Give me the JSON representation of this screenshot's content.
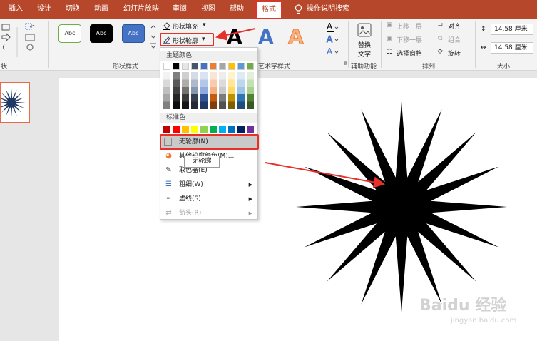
{
  "tabs": [
    {
      "label": "插入"
    },
    {
      "label": "设计"
    },
    {
      "label": "切换"
    },
    {
      "label": "动画"
    },
    {
      "label": "幻灯片放映"
    },
    {
      "label": "审阅"
    },
    {
      "label": "视图"
    },
    {
      "label": "帮助"
    },
    {
      "label": "格式",
      "active": true
    }
  ],
  "tell_me": "操作说明搜索",
  "ribbon": {
    "insert_shapes_group": "状",
    "shape_styles": {
      "label": "形状样式",
      "swatches": [
        "Abc",
        "Abc",
        "Abc"
      ]
    },
    "shape_fill": "形状填充",
    "shape_outline": "形状轮廓",
    "wordart_group": "艺术字样式",
    "wordart_letter": "A",
    "alt_text": {
      "line1": "替换",
      "line2": "文字",
      "group": "辅助功能"
    },
    "arrange": {
      "bring_forward": "上移一层",
      "send_backward": "下移一层",
      "selection_pane": "选择窗格",
      "align": "对齐",
      "group": "组合",
      "rotate": "旋转",
      "label": "排列"
    },
    "size": {
      "height": "14.58 厘米",
      "width": "14.58 厘米",
      "label": "大小"
    }
  },
  "menu": {
    "theme_colors_label": "主题颜色",
    "standard_colors_label": "标准色",
    "no_outline": "无轮廓(N)",
    "more_colors": "其他轮廓颜色(M)...",
    "eyedropper": "取色器(E)",
    "weight": "粗细(W)",
    "dashes": "虚线(S)",
    "arrows": "箭头(R)"
  },
  "tooltip": "无轮廓",
  "colors": {
    "accent": "#b7472a",
    "highlight": "#e8302a",
    "theme_top": [
      "#ffffff",
      "#000000",
      "#e7e6e6",
      "#44546a",
      "#4472c4",
      "#ed7d31",
      "#a5a5a5",
      "#ffc000",
      "#5b9bd5",
      "#70ad47"
    ],
    "theme_shades": [
      [
        "#f2f2f2",
        "#d9d9d9",
        "#bfbfbf",
        "#a6a6a6",
        "#808080"
      ],
      [
        "#7f7f7f",
        "#595959",
        "#404040",
        "#262626",
        "#0d0d0d"
      ],
      [
        "#d0cece",
        "#aeabab",
        "#757171",
        "#3a3838",
        "#171616"
      ],
      [
        "#d6dce5",
        "#adb9ca",
        "#8497b0",
        "#333f50",
        "#222a35"
      ],
      [
        "#dae3f3",
        "#b4c7e7",
        "#8faadc",
        "#2f5597",
        "#1f3864"
      ],
      [
        "#fbe5d6",
        "#f8cbad",
        "#f4b183",
        "#c55a11",
        "#843c0c"
      ],
      [
        "#ededed",
        "#dbdbdb",
        "#c9c9c9",
        "#7b7b7b",
        "#525252"
      ],
      [
        "#fff2cc",
        "#ffe699",
        "#ffd966",
        "#bf9000",
        "#7f6000"
      ],
      [
        "#deebf7",
        "#bdd7ee",
        "#9dc3e6",
        "#2e75b6",
        "#1f4e79"
      ],
      [
        "#e2f0d9",
        "#c5e0b4",
        "#a9d18e",
        "#538135",
        "#385723"
      ]
    ],
    "standard": [
      "#c00000",
      "#ff0000",
      "#ffc000",
      "#ffff00",
      "#92d050",
      "#00b050",
      "#00b0f0",
      "#0070c0",
      "#002060",
      "#7030a0"
    ]
  },
  "watermark": {
    "logo": "Baidu 经验",
    "url": "jingyan.baidu.com"
  }
}
